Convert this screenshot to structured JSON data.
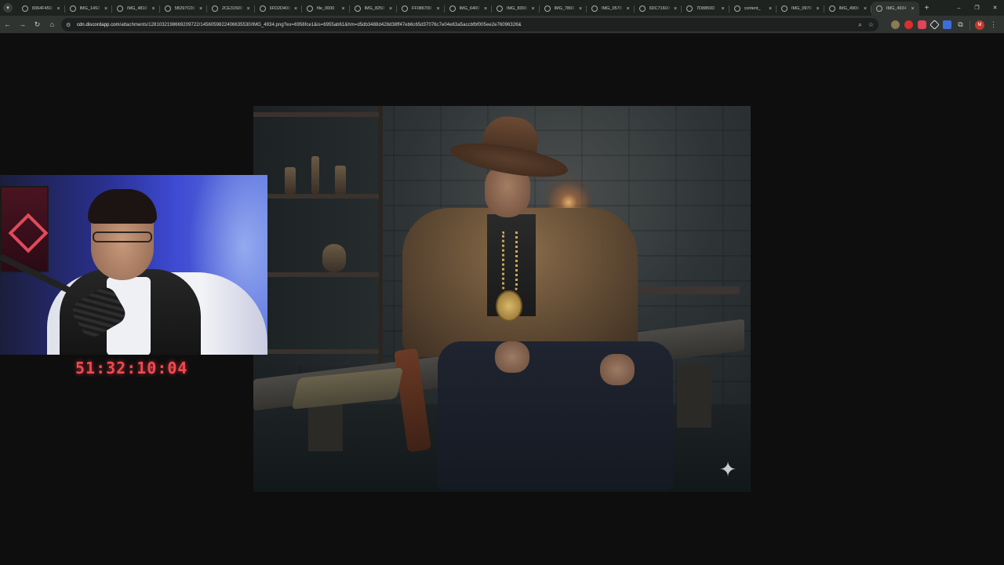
{
  "browser": {
    "tabs": [
      {
        "title": "8364F45D",
        "active": false
      },
      {
        "title": "IMG_1492",
        "active": false
      },
      {
        "title": "IMG_4810",
        "active": false
      },
      {
        "title": "5B297C00",
        "active": false
      },
      {
        "title": "2CE31500",
        "active": false
      },
      {
        "title": "6FD2D400",
        "active": false
      },
      {
        "title": "file_0000",
        "active": false
      },
      {
        "title": "IMG_8250",
        "active": false
      },
      {
        "title": "FF086700",
        "active": false
      },
      {
        "title": "IMG_6400",
        "active": false
      },
      {
        "title": "IMG_8300",
        "active": false
      },
      {
        "title": "IMG_7800",
        "active": false
      },
      {
        "title": "IMG_0570",
        "active": false
      },
      {
        "title": "6DC71600",
        "active": false
      },
      {
        "title": "7D8850D",
        "active": false
      },
      {
        "title": "content_",
        "active": false
      },
      {
        "title": "IMG_0970",
        "active": false
      },
      {
        "title": "IMG_4900",
        "active": false
      },
      {
        "title": "IMG_4934",
        "active": true
      }
    ],
    "close_glyph": "×",
    "newtab_glyph": "+",
    "address": {
      "host": "cdn.discordapp.com",
      "path": "/attachments/1281032198669209722/1456059822406635530/IMG_4934.png?ex=6956fce1&is=6955ab61&hm=d5db3488d428d38ff47eb6c65d37076c7e04e63a5accbfbf005ee2e76096326&"
    },
    "avatar_letter": "M",
    "window_controls": [
      "–",
      "❐",
      "✕"
    ]
  },
  "overlay": {
    "timer": "51:32:10:04"
  },
  "image": {
    "sparkle_glyph": "✦"
  }
}
